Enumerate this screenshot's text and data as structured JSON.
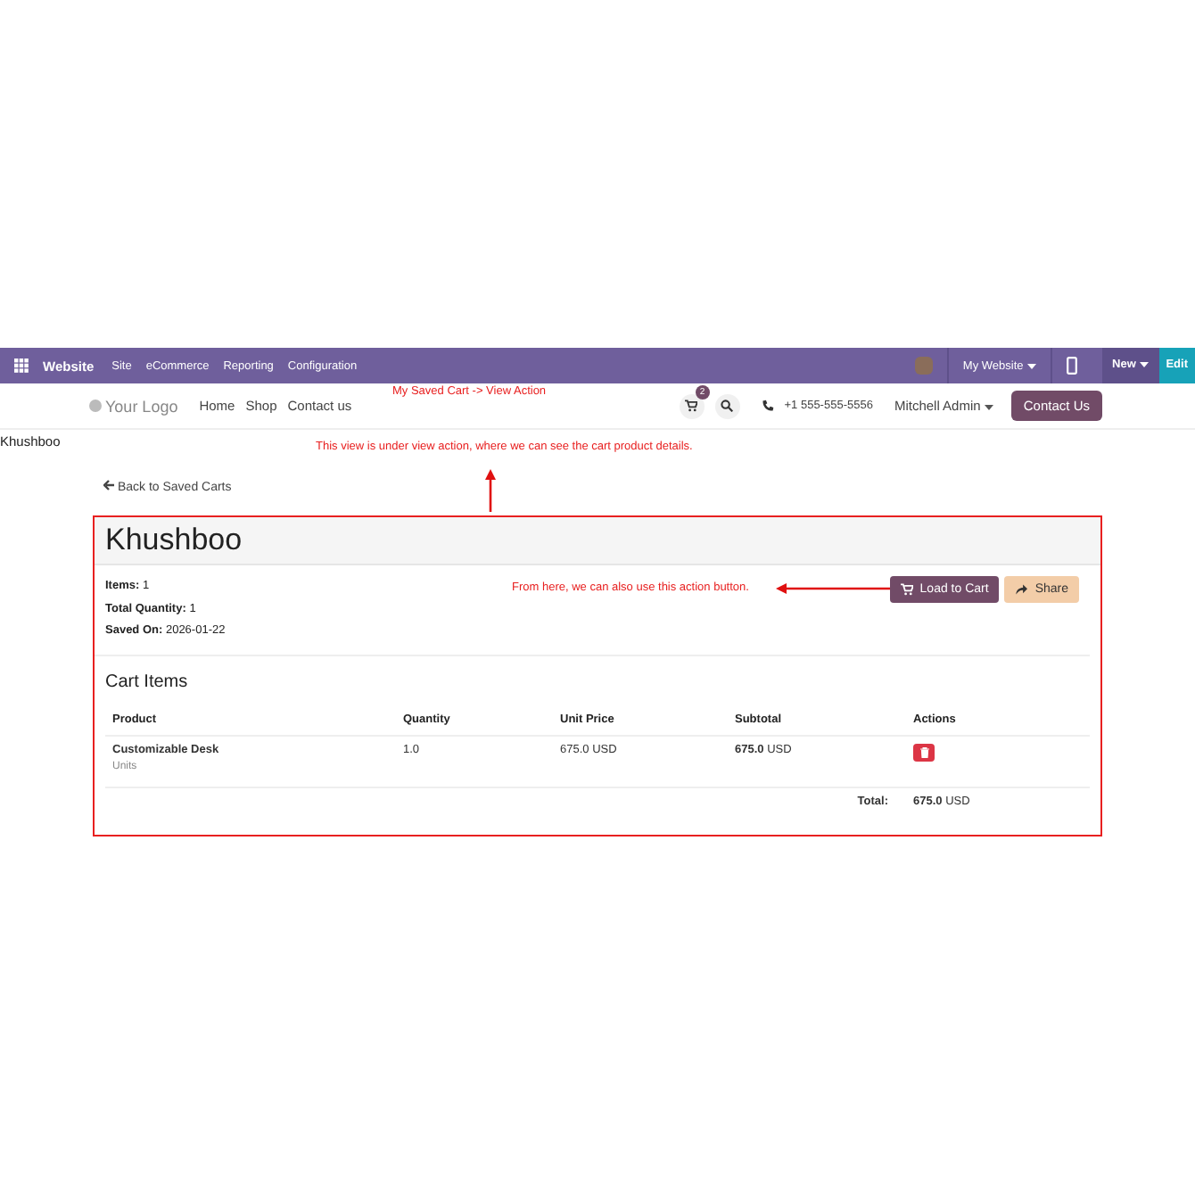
{
  "admin_bar": {
    "app": "Website",
    "menus": [
      "Site",
      "eCommerce",
      "Reporting",
      "Configuration"
    ],
    "website": "My Website",
    "new": "New",
    "edit": "Edit"
  },
  "header": {
    "logo": "Your Logo",
    "nav": [
      "Home",
      "Shop",
      "Contact us"
    ],
    "cart_count": "2",
    "phone": "+1 555-555-5556",
    "user": "Mitchell Admin",
    "cta": "Contact Us"
  },
  "page_user": "Khushboo",
  "back_link": "Back to Saved Carts",
  "cart": {
    "title": "Khushboo",
    "info": [
      {
        "label": "Items:",
        "value": "1"
      },
      {
        "label": "Total Quantity:",
        "value": "1"
      },
      {
        "label": "Saved On:",
        "value": "2026-01-22"
      }
    ],
    "buttons": [
      {
        "label": "Load to Cart",
        "kind": "load"
      },
      {
        "label": "Share",
        "kind": "share"
      }
    ],
    "section_title": "Cart Items",
    "columns": [
      "Product",
      "Quantity",
      "Unit Price",
      "Subtotal",
      "Actions"
    ],
    "rows": [
      {
        "product": "Customizable Desk",
        "unit": "Units",
        "quantity": "1.0",
        "unit_price": "675.0 USD",
        "subtotal_value": "675.0",
        "subtotal_currency": "USD"
      }
    ],
    "total_label": "Total:",
    "total_value": "675.0",
    "total_currency": "USD"
  },
  "annotations": [
    {
      "kind": "header",
      "text": "My Saved Cart -> View Action"
    },
    {
      "kind": "view",
      "text": "This view is under view action, where we can see the cart product details."
    },
    {
      "kind": "buttons",
      "text": "From here, we can also use this action button."
    }
  ]
}
